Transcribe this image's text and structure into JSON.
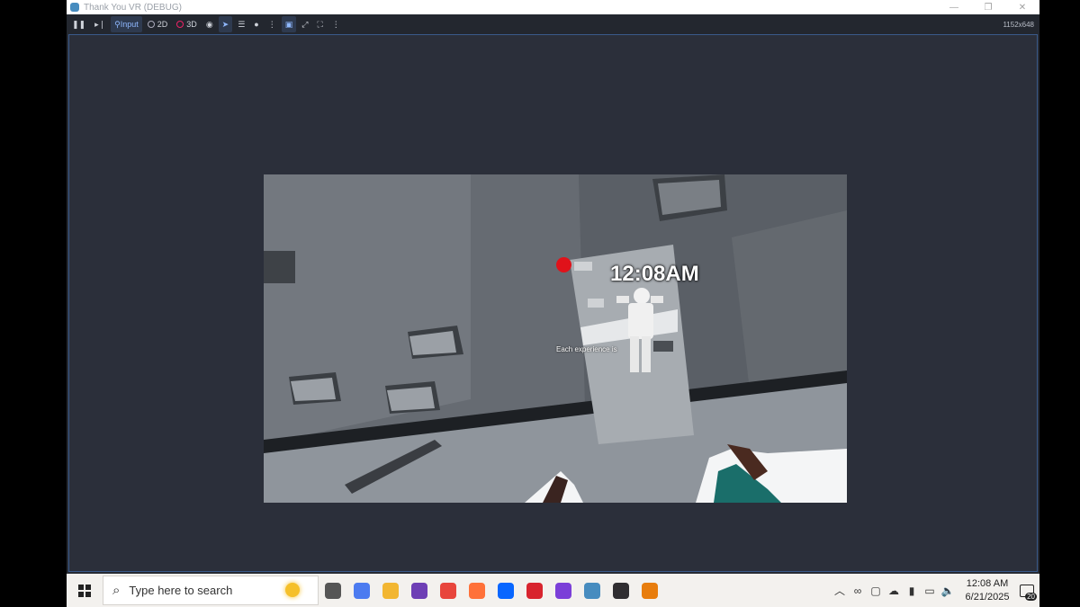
{
  "window": {
    "title": "Thank You VR (DEBUG)"
  },
  "toolbar": {
    "pause_icon": "pause-icon",
    "step_icon": "step-icon",
    "input_label": "Input",
    "mode_2d_label": "2D",
    "mode_3d_label": "3D",
    "resolution": "1152x648"
  },
  "game": {
    "clock_text": "12:08AM",
    "caption": "Each experience is"
  },
  "taskbar": {
    "search_placeholder": "Type here to search",
    "apps": [
      {
        "name": "task-view-icon",
        "color": "#555555"
      },
      {
        "name": "copilot-icon",
        "color": "#4c7bf0"
      },
      {
        "name": "file-explorer-icon",
        "color": "#f2b632"
      },
      {
        "name": "github-desktop-icon",
        "color": "#6e3fb5"
      },
      {
        "name": "chrome-icon",
        "color": "#e8453c"
      },
      {
        "name": "firefox-icon",
        "color": "#ff7139"
      },
      {
        "name": "meta-icon",
        "color": "#0866ff"
      },
      {
        "name": "app-red-icon",
        "color": "#d8242e"
      },
      {
        "name": "app-purple-icon",
        "color": "#7b3fd8"
      },
      {
        "name": "godot-icon",
        "color": "#478cbf"
      },
      {
        "name": "obs-icon",
        "color": "#302e31"
      },
      {
        "name": "blender-icon",
        "color": "#e87d0d"
      }
    ],
    "time": "12:08 AM",
    "date": "6/21/2025",
    "notification_count": "20"
  }
}
